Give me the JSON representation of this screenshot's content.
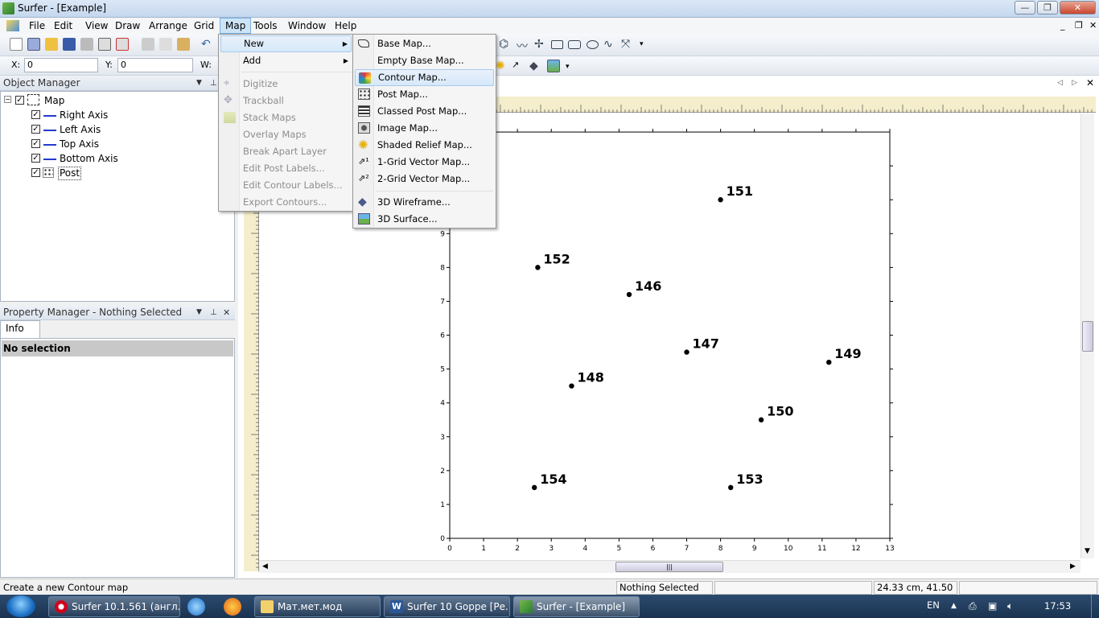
{
  "window": {
    "title": "Surfer - [Example]"
  },
  "menubar": {
    "items": [
      "File",
      "Edit",
      "View",
      "Draw",
      "Arrange",
      "Grid",
      "Map",
      "Tools",
      "Window",
      "Help"
    ],
    "active": "Map"
  },
  "coords": {
    "x_label": "X:",
    "x_value": "0",
    "y_label": "Y:",
    "y_value": "0",
    "w_label": "W:"
  },
  "object_manager": {
    "title": "Object Manager",
    "root": "Map",
    "children": [
      "Right Axis",
      "Left Axis",
      "Top Axis",
      "Bottom Axis",
      "Post"
    ]
  },
  "property_manager": {
    "title": "Property Manager - Nothing Selected",
    "tab": "Info",
    "status": "No selection"
  },
  "map_menu": {
    "items": [
      {
        "label": "New",
        "submenu": true,
        "enabled": true
      },
      {
        "label": "Add",
        "submenu": true,
        "enabled": true
      },
      {
        "label": "Digitize",
        "enabled": false
      },
      {
        "label": "Trackball",
        "enabled": false
      },
      {
        "label": "Stack Maps",
        "enabled": false
      },
      {
        "label": "Overlay Maps",
        "enabled": false
      },
      {
        "label": "Break Apart Layer",
        "enabled": false
      },
      {
        "label": "Edit Post Labels...",
        "enabled": false
      },
      {
        "label": "Edit Contour Labels...",
        "enabled": false
      },
      {
        "label": "Export Contours...",
        "enabled": false
      }
    ]
  },
  "new_submenu": {
    "items": [
      {
        "label": "Base Map...",
        "icon": "base-map-icon"
      },
      {
        "label": "Empty Base Map...",
        "icon": "none"
      },
      {
        "label": "Contour Map...",
        "icon": "contour-map-icon"
      },
      {
        "label": "Post Map...",
        "icon": "post-map-icon"
      },
      {
        "label": "Classed Post Map...",
        "icon": "classed-post-map-icon"
      },
      {
        "label": "Image Map...",
        "icon": "image-map-icon"
      },
      {
        "label": "Shaded Relief Map...",
        "icon": "shaded-relief-icon"
      },
      {
        "label": "1-Grid Vector Map...",
        "icon": "vector-1-icon"
      },
      {
        "label": "2-Grid Vector Map...",
        "icon": "vector-2-icon"
      },
      {
        "label": "3D Wireframe...",
        "icon": "wireframe-icon"
      },
      {
        "label": "3D Surface...",
        "icon": "surface-icon"
      }
    ],
    "highlighted": "Contour Map..."
  },
  "chart_data": {
    "type": "scatter",
    "xlim": [
      0,
      13
    ],
    "ylim": [
      0,
      9
    ],
    "x_ticks": [
      0,
      1,
      2,
      3,
      4,
      5,
      6,
      7,
      8,
      9,
      10,
      11,
      12,
      13
    ],
    "y_ticks": [
      0,
      1,
      2,
      3,
      4,
      5,
      6,
      7,
      8,
      9
    ],
    "points": [
      {
        "label": "151",
        "x": 8.0,
        "y": 10.0
      },
      {
        "label": "152",
        "x": 2.6,
        "y": 8.0
      },
      {
        "label": "146",
        "x": 5.3,
        "y": 7.2
      },
      {
        "label": "147",
        "x": 7.0,
        "y": 5.5
      },
      {
        "label": "149",
        "x": 11.2,
        "y": 5.2
      },
      {
        "label": "148",
        "x": 3.6,
        "y": 4.5
      },
      {
        "label": "150",
        "x": 9.2,
        "y": 3.5
      },
      {
        "label": "154",
        "x": 2.5,
        "y": 1.5
      },
      {
        "label": "153",
        "x": 8.3,
        "y": 1.5
      }
    ]
  },
  "statusbar": {
    "message": "Create a new Contour map",
    "selection": "Nothing Selected",
    "position": "24.33 cm, 41.50 cm"
  },
  "taskbar": {
    "buttons": [
      "Surfer 10.1.561 (англ...",
      "Мат.мет.мод",
      "Surfer 10 Goppe [Ре...",
      "Surfer - [Example]"
    ],
    "lang": "EN",
    "time": "17:53"
  },
  "colors": {
    "accent": "#3399ff",
    "axis_blue": "#223ad0",
    "ruler": "#f5eecc"
  }
}
